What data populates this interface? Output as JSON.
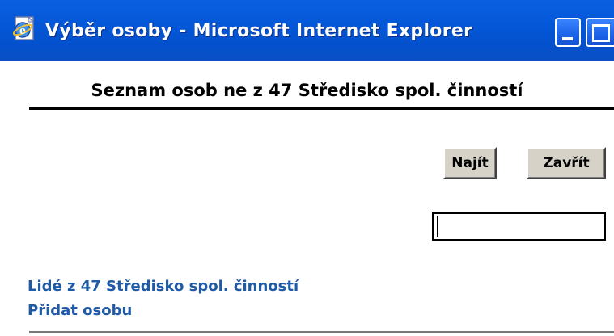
{
  "window": {
    "title": "Výběr osoby - Microsoft Internet Explorer",
    "icon": "ie-page-icon",
    "controls": [
      "minimize-icon",
      "maximize-icon"
    ]
  },
  "page": {
    "heading": "Seznam osob ne z 47 Středisko spol. činností"
  },
  "toolbar": {
    "find_label": "Najít",
    "close_label": "Zavřít"
  },
  "search": {
    "value": ""
  },
  "links": {
    "people_label": "Lidé z 47 Středisko spol. činností",
    "add_person_label": "Přidat osobu"
  },
  "colors": {
    "titlebar": "#0458d8",
    "link": "#1f5aa6",
    "button_face": "#d6d2c8"
  }
}
